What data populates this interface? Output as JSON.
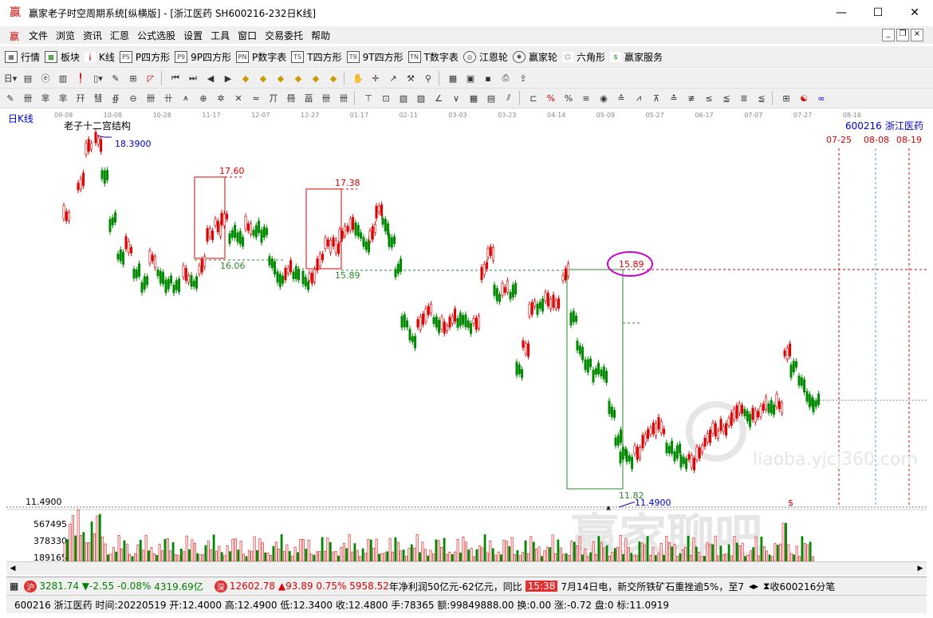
{
  "window": {
    "title": "赢家老子时空周期系统[纵横版] - [浙江医药  SH600216-232日K线]",
    "app_icon": "赢"
  },
  "menu": [
    "文件",
    "浏览",
    "资讯",
    "汇恩",
    "公式选股",
    "设置",
    "工具",
    "窗口",
    "交易委托",
    "帮助"
  ],
  "toolbar1": [
    {
      "icon": "grid-icon",
      "label": "行情"
    },
    {
      "icon": "blocks-icon",
      "label": "板块"
    },
    {
      "icon": "kline-icon",
      "label": "K线"
    },
    {
      "icon": "ps-icon",
      "label": "P四方形",
      "code": "PS"
    },
    {
      "icon": "p9-icon",
      "label": "9P四方形",
      "code": "P9"
    },
    {
      "icon": "pn-icon",
      "label": "P数字表",
      "code": "PN"
    },
    {
      "icon": "ts-icon",
      "label": "T四方形",
      "code": "TS"
    },
    {
      "icon": "t9-icon",
      "label": "9T四方形",
      "code": "T9"
    },
    {
      "icon": "tn-icon",
      "label": "T数字表",
      "code": "TN"
    },
    {
      "icon": "target-icon",
      "label": "江恩轮"
    },
    {
      "icon": "wheel-icon",
      "label": "赢家轮"
    },
    {
      "icon": "hexagon-icon",
      "label": "六角形"
    },
    {
      "icon": "dollar-icon",
      "label": "赢家服务"
    }
  ],
  "chart": {
    "period_label": "日K线",
    "indicator_title": "老子十二宫结构",
    "stock_code": "600216",
    "stock_name": "浙江医药",
    "date_ticks": [
      "09-09",
      "10-08",
      "10-28",
      "11-17",
      "12-07",
      "12-27",
      "01-17",
      "02-11",
      "03-03",
      "03-23",
      "04-14",
      "05-09",
      "05-27",
      "06-17",
      "07-07",
      "07-27",
      "08-16"
    ],
    "future_dates": [
      "07-25",
      "08-08",
      "08-19"
    ],
    "labels": {
      "high": "18.3900",
      "low": "11.4900",
      "box1_top": "17.60",
      "box1_bottom": "16.06",
      "box2_top": "17.38",
      "box2_bottom": "15.89",
      "box3_top": "15.89",
      "box3_bottom": "11.82",
      "dollar": "$"
    },
    "price_axis_low": "11.4900",
    "volume_ticks": [
      "567495",
      "378330",
      "189165"
    ],
    "watermark_cn": "赢家聊吧",
    "watermark_en": "liaoba.yjcj360.com"
  },
  "chart_data": {
    "type": "candlestick",
    "title": "老子十二宫结构",
    "ylim": [
      11.49,
      18.39
    ],
    "annotated_high": 18.39,
    "annotated_low": 11.49,
    "levels": [
      17.6,
      16.06,
      17.38,
      15.89,
      11.82
    ]
  },
  "status1": {
    "sh_badge": "沪",
    "sh_index": "3281.74",
    "sh_change": "▼-2.55",
    "sh_pct": "-0.08%",
    "sh_amount": "4319.69亿",
    "sz_badge": "深",
    "sz_index": "12602.78",
    "sz_change": "▲93.89",
    "sz_pct": "0.75%",
    "sz_amount": "5958.52",
    "news1": "年净利润50亿元-62亿元，同比",
    "news_time": "15:38",
    "news2": "7月14日电，新交所铁矿石重挫逾5%，至7",
    "tick_label": "收600216分笔"
  },
  "status2": {
    "text": "600216 浙江医药 时间:20220519 开:12.4000 高:12.4900 低:12.3400 收:12.4800 手:78365 额:99849888.00 换:0.00 涨:-0.72 盘:0 标:11.0919"
  }
}
